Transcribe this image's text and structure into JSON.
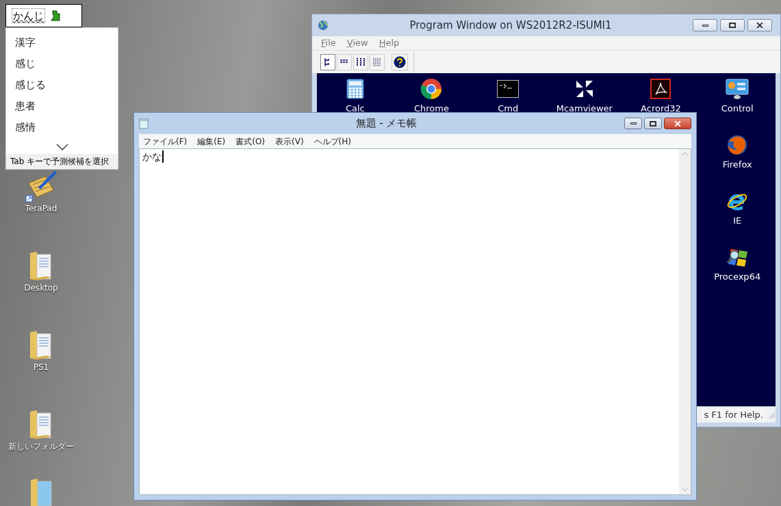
{
  "ime": {
    "composition": "かんじ",
    "candidates": [
      "漢字",
      "感じ",
      "感じる",
      "患者",
      "感情"
    ],
    "hint": "Tab キーで予測候補を選択"
  },
  "desktop_icons": [
    {
      "label": "TeraPad",
      "kind": "app"
    },
    {
      "label": "Desktop",
      "kind": "folder"
    },
    {
      "label": "PS1",
      "kind": "folder"
    },
    {
      "label": "新しいフォルダー",
      "kind": "folder"
    }
  ],
  "program_window": {
    "title": "Program Window on WS2012R2-ISUMI1",
    "menu": [
      "File",
      "View",
      "Help"
    ],
    "apps": [
      {
        "label": "Calc",
        "kind": "calc"
      },
      {
        "label": "Chrome",
        "kind": "chrome"
      },
      {
        "label": "Cmd",
        "kind": "cmd"
      },
      {
        "label": "Mcamviewer",
        "kind": "arrows"
      },
      {
        "label": "Acrord32",
        "kind": "pdf"
      },
      {
        "label": "Control",
        "kind": "control"
      },
      {
        "label": "Firefox",
        "kind": "firefox"
      },
      {
        "label": "IE",
        "kind": "ie"
      },
      {
        "label": "Procexp64",
        "kind": "procexp"
      }
    ],
    "status_bar": "s F1 for Help."
  },
  "notepad": {
    "title": "無題 - メモ帳",
    "menu": [
      "ファイル(F)",
      "編集(E)",
      "書式(O)",
      "表示(V)",
      "ヘルプ(H)"
    ],
    "content": "かな"
  }
}
